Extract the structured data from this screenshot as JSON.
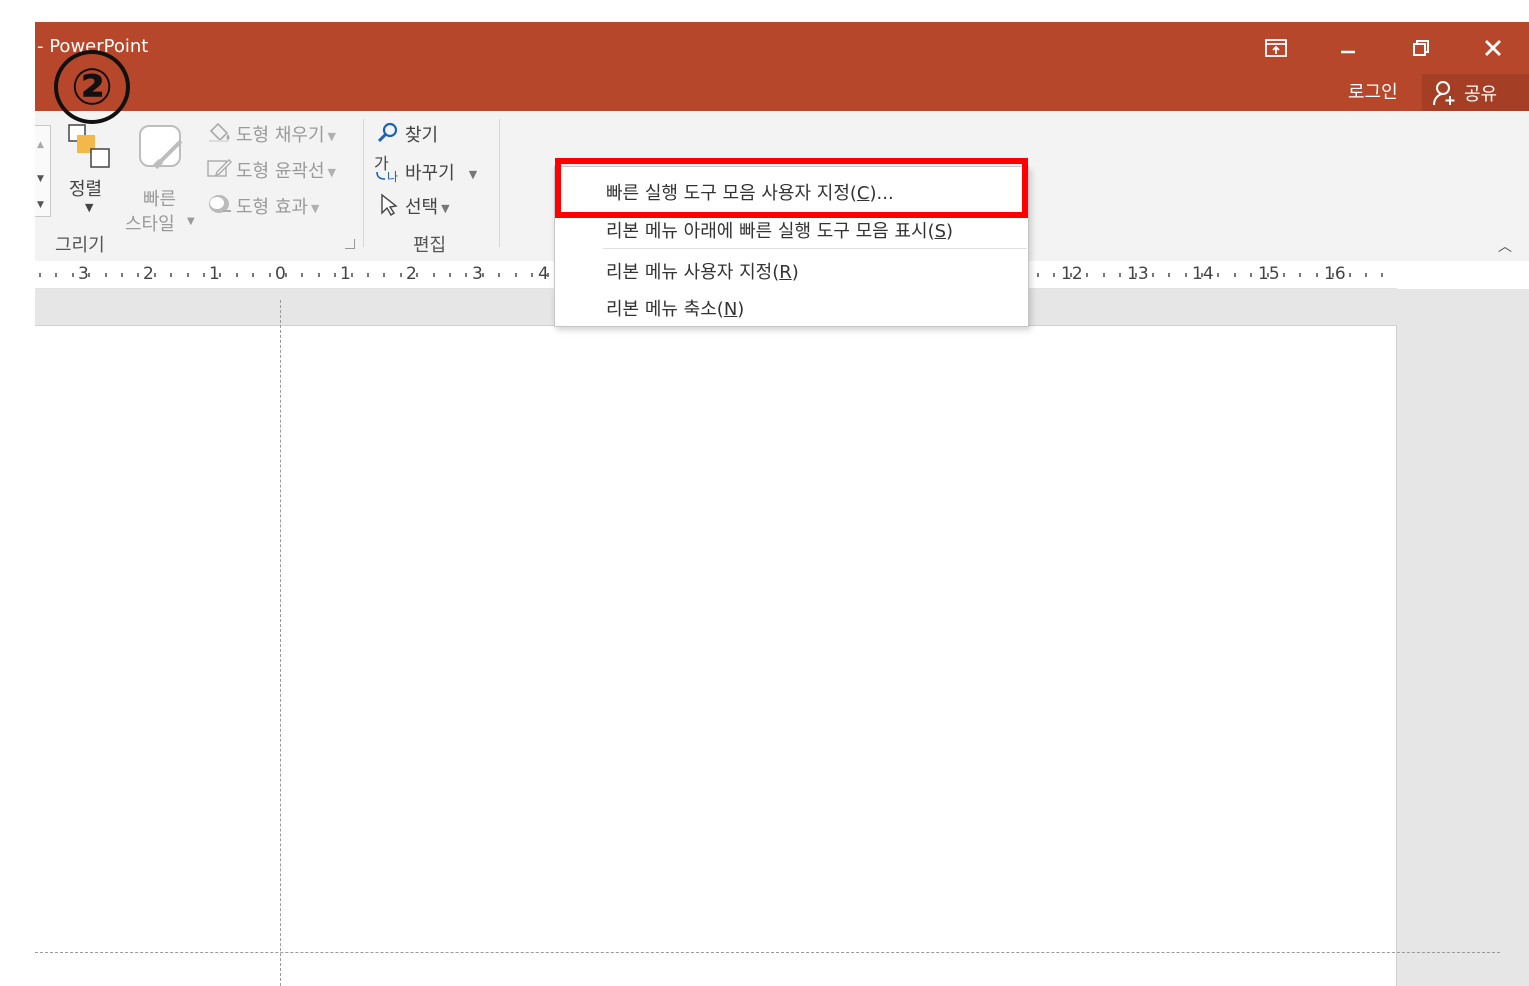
{
  "window": {
    "title": "- PowerPoint",
    "login": "로그인",
    "share": "공유",
    "annotation_marker": "②"
  },
  "ribbon": {
    "arrange_label": "정렬",
    "quick_styles_line1": "빠른",
    "quick_styles_line2": "스타일",
    "shape_fill": "도형 채우기",
    "shape_outline": "도형 윤곽선",
    "shape_effects": "도형 효과",
    "drawing_group": "그리기",
    "find": "찾기",
    "replace": "바꾸기",
    "select": "선택",
    "editing_group": "편집"
  },
  "ruler": {
    "labels": [
      "3",
      "2",
      "1",
      "0",
      "1",
      "2",
      "3",
      "4",
      "12",
      "13",
      "14",
      "15",
      "16"
    ]
  },
  "context_menu": {
    "items": [
      {
        "text": "빠른 실행 도구 모음 사용자 지정(",
        "key": "C",
        "suffix": ")..."
      },
      {
        "text": "리본 메뉴 아래에 빠른 실행 도구 모음 표시(",
        "key": "S",
        "suffix": ")"
      },
      {
        "text": "리본 메뉴 사용자 지정(",
        "key": "R",
        "suffix": ")"
      },
      {
        "text": "리본 메뉴 축소(",
        "key": "N",
        "suffix": ")"
      }
    ]
  },
  "colors": {
    "titlebar": "#b7472a",
    "share_bg": "#a43e24",
    "highlight_box": "#ff0000",
    "ribbon_bg": "#f3f3f3"
  },
  "icons": [
    "restore-ribbon-icon",
    "minimize-icon",
    "maximize-icon",
    "close-icon",
    "person-add-icon",
    "arrange-icon",
    "quick-styles-icon",
    "paint-bucket-icon",
    "pencil-icon",
    "effects-icon",
    "magnifier-icon",
    "replace-icon",
    "cursor-icon",
    "chevron-up-icon"
  ]
}
